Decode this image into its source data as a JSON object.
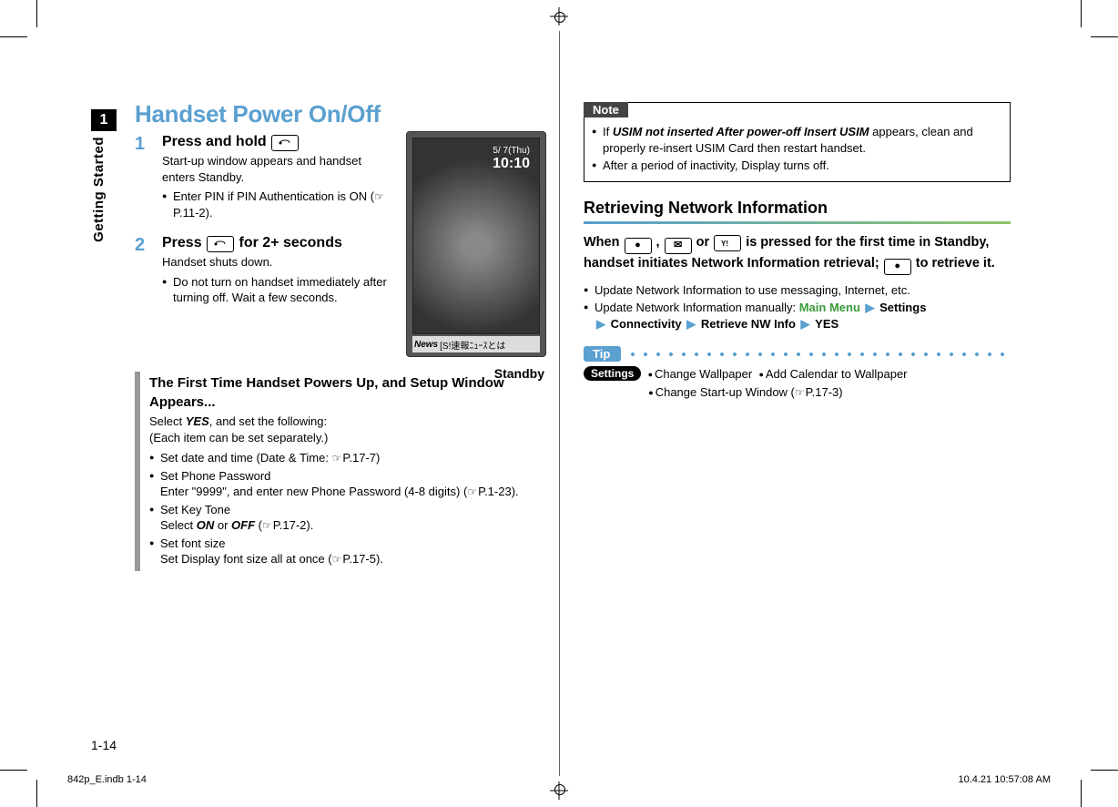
{
  "chapter": {
    "number": "1",
    "side_label": "Getting Started"
  },
  "title": "Handset Power On/Off",
  "steps": [
    {
      "num": "1",
      "title_before": "Press and hold ",
      "key_icon": "power-key-icon",
      "title_after": "",
      "desc": "Start-up window appears and handset enters Standby.",
      "bullets": [
        {
          "text_before": "Enter PIN if PIN Authentication is ON (",
          "ref": "P.11-2",
          "text_after": ")."
        }
      ]
    },
    {
      "num": "2",
      "title_before": "Press ",
      "key_icon": "power-key-icon",
      "title_after": " for 2+ seconds",
      "desc": "Handset shuts down.",
      "bullets": [
        {
          "text_before": "Do not turn on handset immediately after turning off. Wait a few seconds.",
          "ref": "",
          "text_after": ""
        }
      ]
    }
  ],
  "figure": {
    "caption": "Standby",
    "date_line": "5/  7(Thu)",
    "time_line": "10:10",
    "ticker_prefix": "News",
    "ticker_text": "[S!速報ﾆｭｰｽとは"
  },
  "first_time": {
    "title": "The First Time Handset Powers Up, and Setup Window Appears...",
    "line1_before": "Select ",
    "line1_strong": "YES",
    "line1_after": ", and set the following:",
    "line2": "(Each item can be set separately.)",
    "items": [
      {
        "head_before": "Set date and time (Date & Time: ",
        "ref": "P.17-7",
        "head_after": ")",
        "sub": ""
      },
      {
        "head_before": "Set Phone Password",
        "ref": "",
        "head_after": "",
        "sub_before": "Enter \"9999\", and enter new Phone Password (4-8 digits) (",
        "sub_ref": "P.1-23",
        "sub_after": ")."
      },
      {
        "head_before": "Set Key Tone",
        "ref": "",
        "head_after": "",
        "sub_before": "Select ",
        "sub_strong1": "ON",
        "sub_mid": " or ",
        "sub_strong2": "OFF",
        "sub_paren_before": " (",
        "sub_ref": "P.17-2",
        "sub_after": ")."
      },
      {
        "head_before": "Set font size",
        "ref": "",
        "head_after": "",
        "sub_before": "Set Display font size all at once (",
        "sub_ref": "P.17-5",
        "sub_after": ")."
      }
    ]
  },
  "note": {
    "label": "Note",
    "items": [
      {
        "before": "If ",
        "strong": "USIM not inserted After power-off Insert USIM",
        "after": " appears, clean and properly re-insert USIM Card then restart handset."
      },
      {
        "before": "After a period of inactivity, Display turns off.",
        "strong": "",
        "after": ""
      }
    ]
  },
  "network": {
    "heading": "Retrieving Network Information",
    "intro_parts": {
      "a": "When ",
      "b": ", ",
      "c": " or ",
      "d": " is pressed for the first time in Standby, handset initiates Network Information retrieval; ",
      "e": " to retrieve it."
    },
    "bullets": [
      "Update Network Information to use messaging, Internet, etc.",
      "Update Network Information manually: "
    ],
    "menu_path": {
      "main": "Main Menu",
      "s1": "Settings",
      "s2": "Connectivity",
      "s3": "Retrieve NW Info",
      "s4": "YES"
    }
  },
  "tip": {
    "label": "Tip",
    "settings_label": "Settings",
    "items": [
      "Change Wallpaper",
      "Add Calendar to Wallpaper"
    ],
    "item3_before": "Change Start-up Window (",
    "item3_ref": "P.17-3",
    "item3_after": ")"
  },
  "page_number": "1-14",
  "footer": {
    "left": "842p_E.indb   1-14",
    "right": "10.4.21   10:57:08 AM"
  }
}
